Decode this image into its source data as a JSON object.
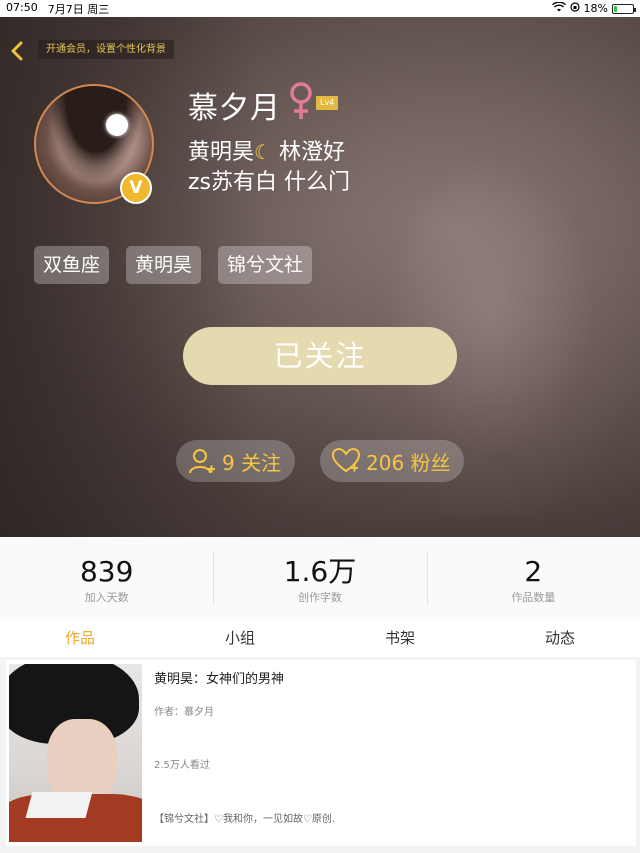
{
  "status_bar": {
    "time": "07:50",
    "date": "7月7日 周三",
    "battery_percent": "18%",
    "battery_level": 0.18
  },
  "header": {
    "vip_hint": "开通会员，设置个性化背景",
    "back_icon": "chevron-left-icon"
  },
  "profile": {
    "username": "慕夕月",
    "gender_icon": "female-icon",
    "level": "Lv4",
    "bio_line1_a": "黄明昊",
    "bio_line1_b": "林澄好",
    "bio_line2": "zs苏有白 什么门",
    "vip_badge": "V",
    "tags": [
      "双鱼座",
      "黄明昊",
      "锦兮文社"
    ]
  },
  "actions": {
    "follow_label": "已关注",
    "following_count_label": "9 关注",
    "followers_count_label": "206 粉丝"
  },
  "stats": [
    {
      "value": "839",
      "label": "加入天数"
    },
    {
      "value": "1.6万",
      "label": "创作字数"
    },
    {
      "value": "2",
      "label": "作品数量"
    }
  ],
  "tabs": [
    "作品",
    "小组",
    "书架",
    "动态"
  ],
  "active_tab": "作品",
  "works": [
    {
      "title": "黄明昊：女神们的男神",
      "author": "作者：慕夕月",
      "views": "2.5万人看过",
      "desc": "【锦兮文社】♡我和你，一见如故♡原创."
    }
  ],
  "colors": {
    "accent": "#f5a623",
    "follow_button": "#e5d9b0",
    "level_badge": "#e5b840",
    "stat_pill_text": "#f6c545"
  }
}
